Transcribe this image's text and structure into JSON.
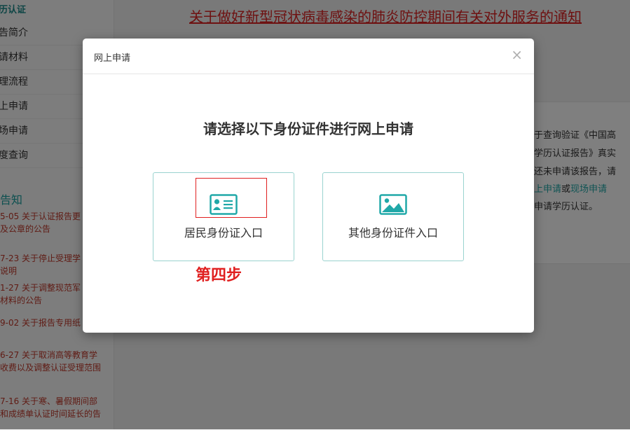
{
  "sidebar": {
    "header": "历认证",
    "items": [
      {
        "label": "告简介"
      },
      {
        "label": "请材料"
      },
      {
        "label": "理流程"
      },
      {
        "label": "上申请"
      },
      {
        "label": "场申请"
      },
      {
        "label": "度查询"
      }
    ],
    "notice_title": "告知",
    "notices": [
      {
        "line1": "5-05 关于认证报告更",
        "line2": "及公章的公告"
      },
      {
        "line1": "7-23 关于停止受理学",
        "line2": "说明"
      },
      {
        "line1": "1-27 关于调整现范军",
        "line2": "材料的公告"
      },
      {
        "line1": "9-02 关于报告专用纸",
        "line2": ""
      },
      {
        "line1": "6-27 关于取消高等教育学",
        "line2": "收费以及调整认证受理范围"
      },
      {
        "line1": "7-16 关于寒、暑假期间部",
        "line2": "和成绩单认证时间延长的告"
      }
    ]
  },
  "news": {
    "link_text": "关于做好新型冠状病毒感染的肺炎防控期间有关对外服务的通知"
  },
  "info": {
    "line1": "于查询验证《中国高",
    "line2": "学历认证报告》真实",
    "line3": "还未申请该报告，请",
    "line4_link1": "上申请",
    "line4_mid": "或",
    "line4_link2": "现场申请",
    "line5": "申请学历认证。"
  },
  "modal": {
    "title": "网上申请",
    "close_symbol": "×",
    "heading": "请选择以下身份证件进行网上申请",
    "options": [
      {
        "label": "居民身份证入口",
        "icon": "id-card-icon"
      },
      {
        "label": "其他身份证件入口",
        "icon": "image-icon"
      }
    ]
  },
  "annotation": {
    "step_label": "第四步",
    "color": "#e02020"
  },
  "colors": {
    "accent": "#20a8a8",
    "card_border": "#9ad3cf",
    "news_link": "#dd2222"
  }
}
